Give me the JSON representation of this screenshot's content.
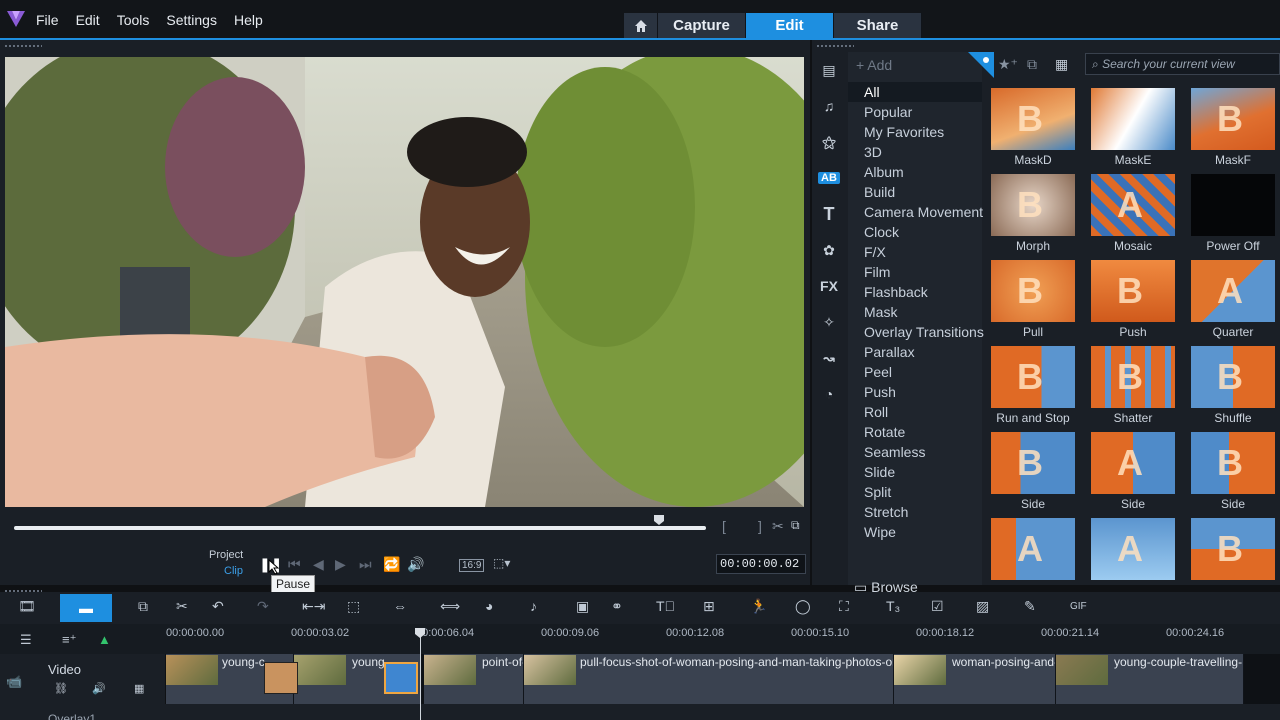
{
  "menu": [
    "File",
    "Edit",
    "Tools",
    "Settings",
    "Help"
  ],
  "modes": {
    "capture": "Capture",
    "edit": "Edit",
    "share": "Share"
  },
  "preview": {
    "project_label": "Project",
    "clip_label": "Clip",
    "timecode": "00:00:00.02",
    "tooltip": "Pause",
    "aspect": "16:9",
    "scrub_progress": 0.93
  },
  "library": {
    "add_label": "Add",
    "search_placeholder": "Search your current view",
    "browse_label": "Browse",
    "categories": [
      "All",
      "Popular",
      "My Favorites",
      "3D",
      "Album",
      "Build",
      "Camera Movement",
      "Clock",
      "F/X",
      "Film",
      "Flashback",
      "Mask",
      "Overlay Transitions",
      "Parallax",
      "Peel",
      "Push",
      "Roll",
      "Rotate",
      "Seamless",
      "Slide",
      "Split",
      "Stretch",
      "Wipe"
    ],
    "selected_category": "All",
    "thumbnails": [
      "MaskD",
      "MaskE",
      "MaskF",
      "Morph",
      "Mosaic",
      "Power Off",
      "Pull",
      "Push",
      "Quarter",
      "Run and Stop",
      "Shatter",
      "Shuffle",
      "Side",
      "Side",
      "Side",
      "",
      "",
      ""
    ]
  },
  "timeline": {
    "ruler": [
      "00:00:00.00",
      "00:00:03.02",
      "00:00:06.04",
      "00:00:09.06",
      "00:00:12.08",
      "00:00:15.10",
      "00:00:18.12",
      "00:00:21.14",
      "00:00:24.16"
    ],
    "video_track": "Video",
    "overlay_track": "Overlay1",
    "clips": [
      "young-c",
      "young",
      "point-of-",
      "pull-focus-shot-of-woman-posing-and-man-taking-photos-or",
      "woman-posing-and-",
      "young-couple-travelling-"
    ]
  },
  "colors": {
    "accent": "#1e8fe0",
    "panel": "#1a1f26",
    "background": "#0f1114"
  }
}
